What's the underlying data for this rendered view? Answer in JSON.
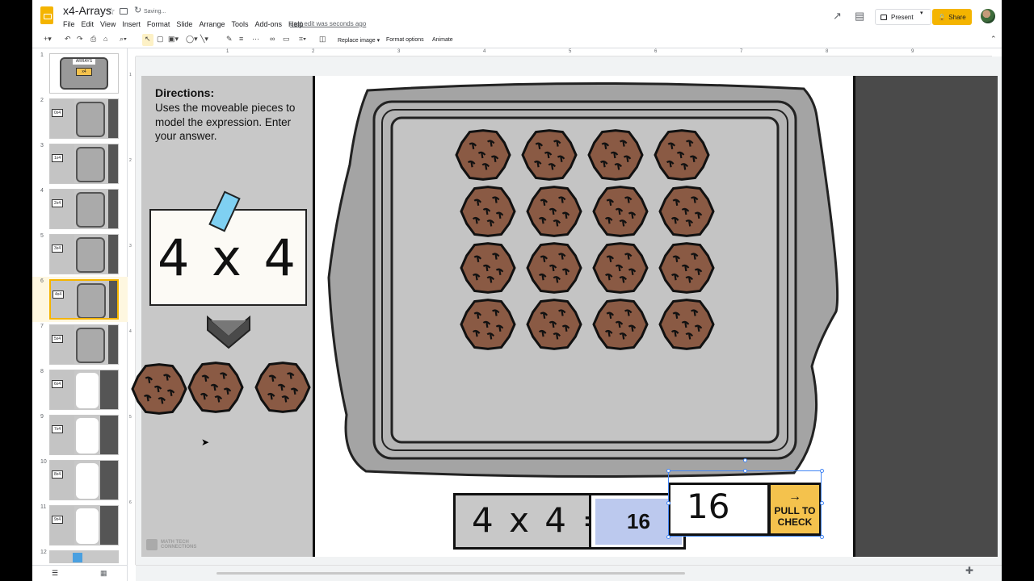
{
  "header": {
    "doc_title": "x4-Arrays",
    "status": "Saving...",
    "menu": [
      "File",
      "Edit",
      "View",
      "Insert",
      "Format",
      "Slide",
      "Arrange",
      "Tools",
      "Add-ons",
      "Help"
    ],
    "last_edit": "Last edit was seconds ago",
    "present_label": "Present",
    "share_label": "Share"
  },
  "toolbar": {
    "replace_image": "Replace image",
    "format_options": "Format options",
    "animate": "Animate"
  },
  "ruler": {
    "ticks": [
      "1",
      "2",
      "3",
      "4",
      "5",
      "6",
      "7",
      "8",
      "9"
    ],
    "vticks": [
      "1",
      "2",
      "3",
      "4",
      "5",
      "6"
    ]
  },
  "filmstrip": {
    "slides": [
      {
        "num": "1",
        "card": ""
      },
      {
        "num": "2",
        "card": "0x4"
      },
      {
        "num": "3",
        "card": "1x4"
      },
      {
        "num": "4",
        "card": "2x4"
      },
      {
        "num": "5",
        "card": "3x4"
      },
      {
        "num": "6",
        "card": "4x4"
      },
      {
        "num": "7",
        "card": "5x4"
      },
      {
        "num": "8",
        "card": "6x4"
      },
      {
        "num": "9",
        "card": "7x4"
      },
      {
        "num": "10",
        "card": "8x4"
      },
      {
        "num": "11",
        "card": "9x4"
      },
      {
        "num": "12",
        "card": ""
      }
    ],
    "selected": "6",
    "first_slide_title": "ARRAYS",
    "first_slide_card": "x4"
  },
  "slide": {
    "directions_title": "Directions:",
    "directions_text": "Uses the moveable pieces to model the expression. Enter your answer.",
    "expression": "4 x 4",
    "equation": "4 x 4 =",
    "answer": "16",
    "check_value": "16",
    "pull_arrow": "→",
    "pull_label": "PULL TO\nCHECK",
    "logo_line1": "MATH TECH",
    "logo_line2": "CONNECTIONS"
  },
  "colors": {
    "accent": "#f4b400",
    "answer_fill": "#bcc9ee",
    "pull_button": "#f4c24d",
    "cookie": "#8a5a44"
  }
}
